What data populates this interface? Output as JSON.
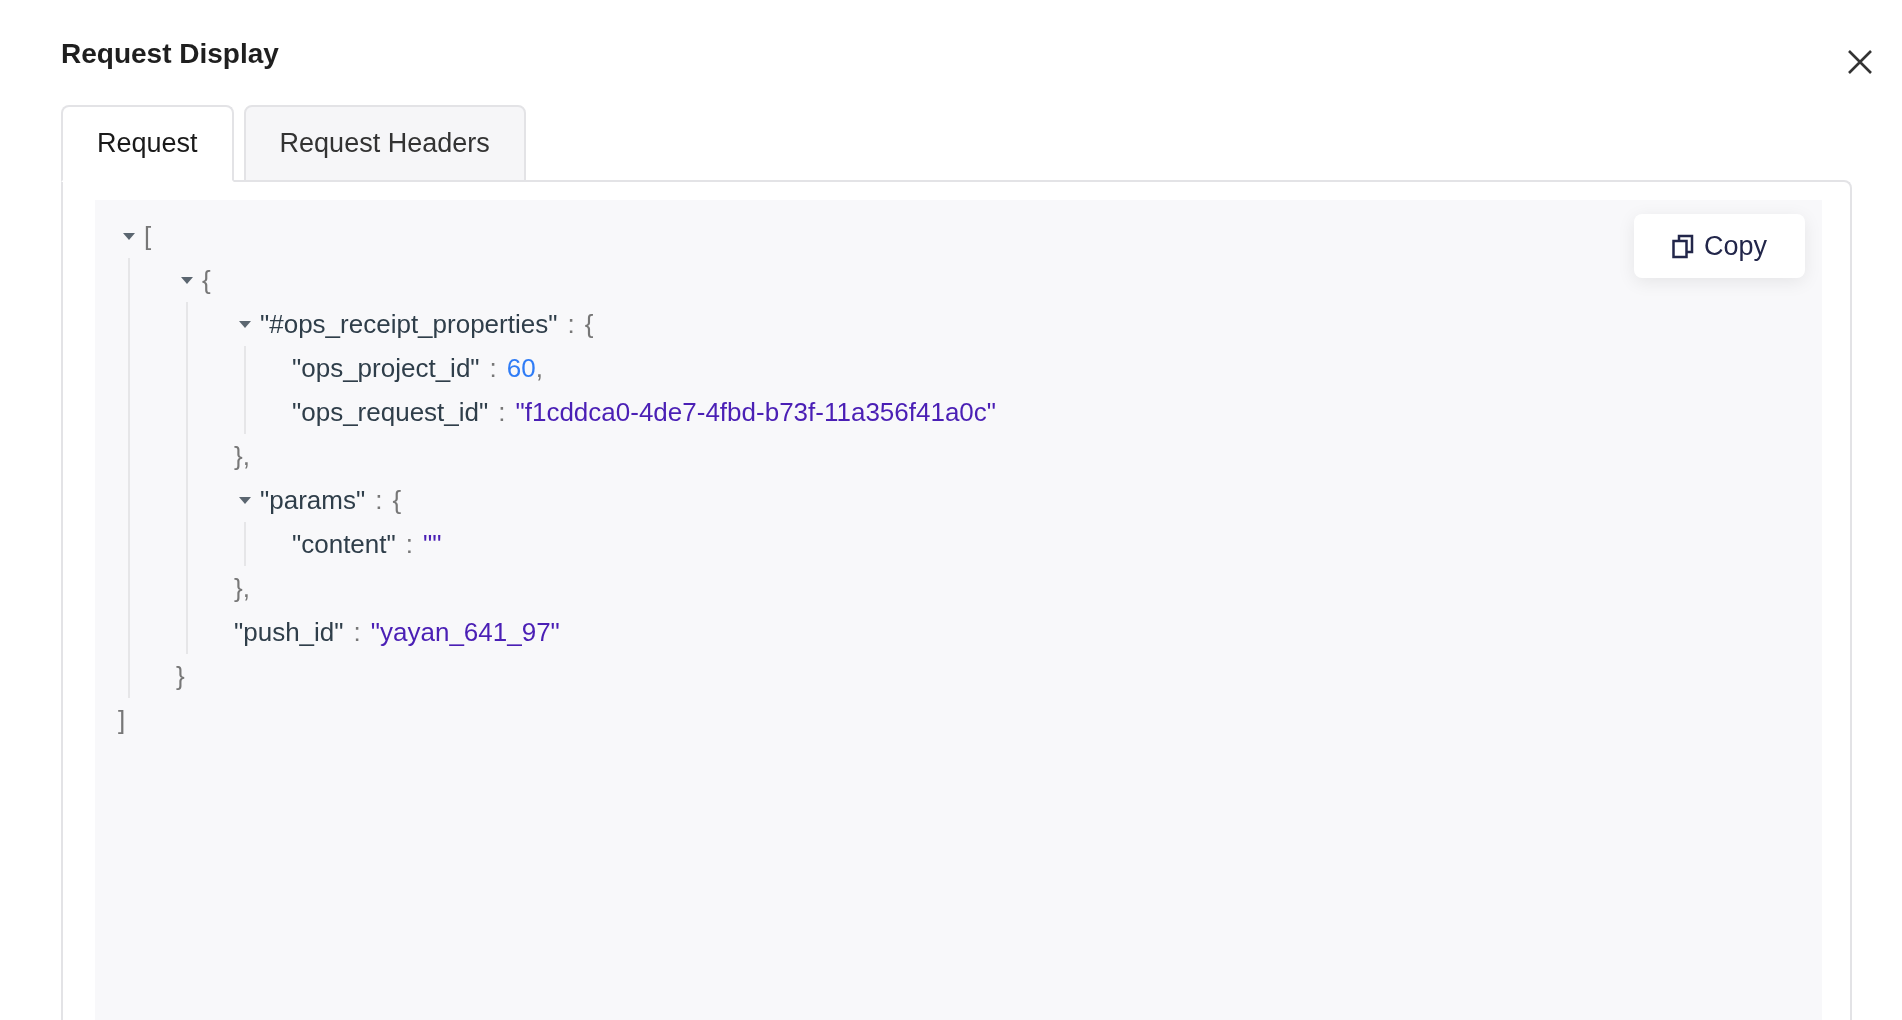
{
  "dialog": {
    "title": "Request Display"
  },
  "tabs": [
    {
      "label": "Request",
      "selected": true
    },
    {
      "label": "Request Headers",
      "selected": false
    }
  ],
  "copy_button": {
    "label": "Copy"
  },
  "json_tree": {
    "kind": "array",
    "open": "[",
    "close": "]",
    "expanded": true,
    "children": [
      {
        "kind": "object",
        "open": "{",
        "close": "}",
        "expanded": true,
        "children": [
          {
            "kind": "object",
            "key": "\"#ops_receipt_properties\"",
            "colon": ":",
            "open": "{",
            "close": "},",
            "expanded": true,
            "children": [
              {
                "kind": "number",
                "key": "\"ops_project_id\"",
                "colon": ":",
                "value": "60",
                "punct": ","
              },
              {
                "kind": "string",
                "key": "\"ops_request_id\"",
                "colon": ":",
                "value": "\"f1cddca0-4de7-4fbd-b73f-11a356f41a0c\""
              }
            ]
          },
          {
            "kind": "object",
            "key": "\"params\"",
            "colon": ":",
            "open": "{",
            "close": "},",
            "expanded": true,
            "children": [
              {
                "kind": "string",
                "key": "\"content\"",
                "colon": ":",
                "value": "\"\""
              }
            ]
          },
          {
            "kind": "string",
            "key": "\"push_id\"",
            "colon": ":",
            "value": "\"yayan_641_97\""
          }
        ]
      }
    ]
  }
}
